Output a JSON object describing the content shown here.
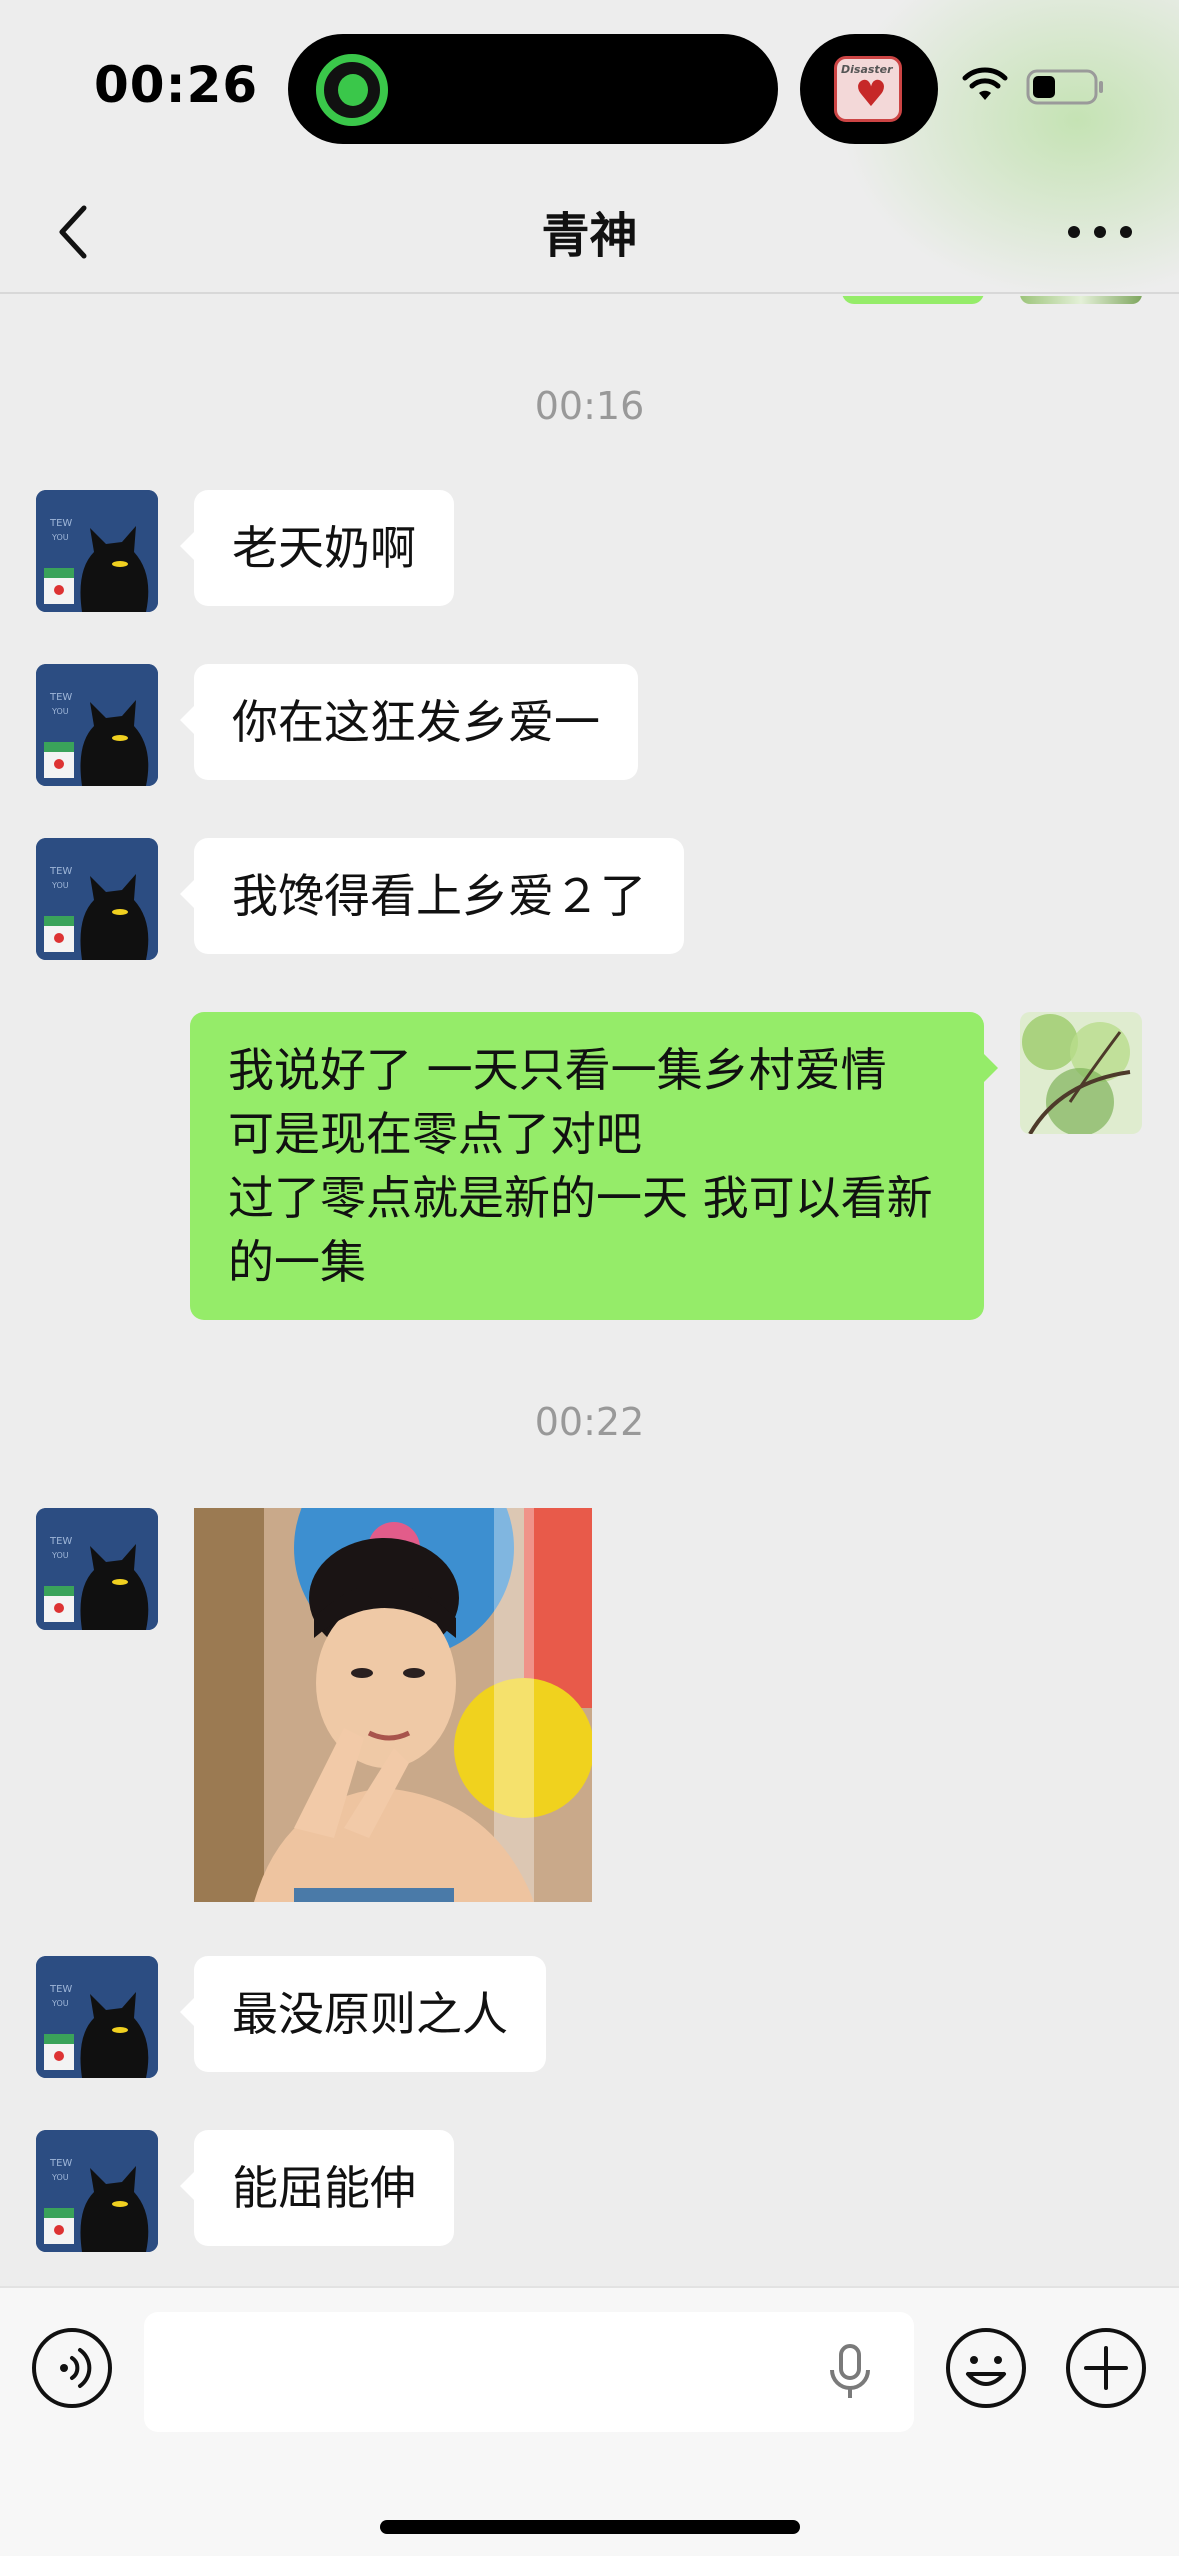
{
  "status_bar": {
    "time": "00:26",
    "island_art_text": "Disaster",
    "icons": [
      "wifi-icon",
      "battery-icon"
    ]
  },
  "nav": {
    "title": "青神",
    "back_icon": "chevron-left-icon",
    "more_icon": "more-dots-icon"
  },
  "messages": [
    {
      "type": "time",
      "text": "00:16"
    },
    {
      "type": "text",
      "side": "left",
      "text": "老天奶啊"
    },
    {
      "type": "text",
      "side": "left",
      "text": "你在这狂发乡爱一"
    },
    {
      "type": "text",
      "side": "left",
      "text": "我馋得看上乡爱２了"
    },
    {
      "type": "text",
      "side": "right",
      "text": "我说好了 一天只看一集乡村爱情\n可是现在零点了对吧\n过了零点就是新的一天 我可以看新的一集"
    },
    {
      "type": "time",
      "text": "00:22"
    },
    {
      "type": "image",
      "side": "left"
    },
    {
      "type": "text",
      "side": "left",
      "text": "最没原则之人"
    },
    {
      "type": "text",
      "side": "left",
      "text": "能屈能伸"
    }
  ],
  "input_bar": {
    "placeholder": "",
    "icons": [
      "voice-icon",
      "mic-icon",
      "emoji-icon",
      "plus-icon"
    ]
  },
  "colors": {
    "background": "#ededed",
    "bubble_me": "#95ec69",
    "bubble_other": "#ffffff",
    "time_label": "#999999"
  }
}
